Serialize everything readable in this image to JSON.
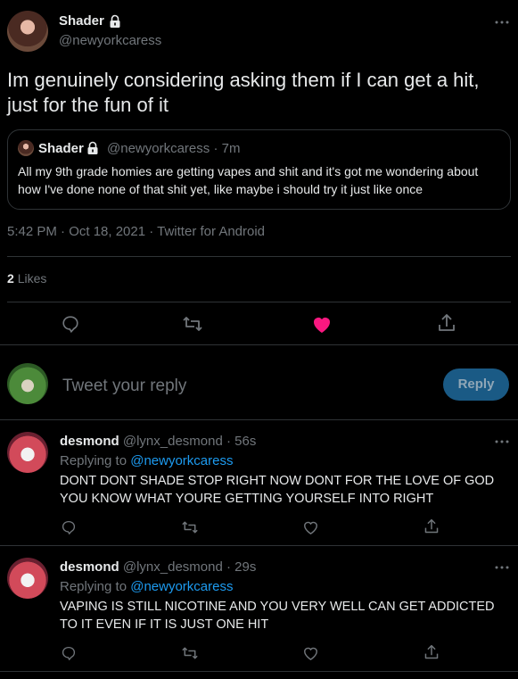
{
  "main_tweet": {
    "display_name": "Shader",
    "handle": "@newyorkcaress",
    "text": "Im genuinely considering asking them if I can get a hit, just for the fun of it",
    "timestamp": "5:42 PM · Oct 18, 2021 · Twitter for Android",
    "likes_count": "2",
    "likes_label": "Likes",
    "like_color": "#f91880"
  },
  "quoted_tweet": {
    "display_name": "Shader",
    "handle": "@newyorkcaress",
    "time": "· 7m",
    "text": "All my 9th grade homies are getting vapes and shit and it's got me wondering about how I've done none of that shit yet, like maybe i should try it just like once"
  },
  "reply_box": {
    "placeholder": "Tweet your reply",
    "button_label": "Reply",
    "button_color": "#1d9bf0"
  },
  "replies": [
    {
      "display_name": "desmond",
      "handle": "@lynx_desmond",
      "time": "· 56s",
      "replying_prefix": "Replying to",
      "replying_to": "@newyorkcaress",
      "text": "DONT DONT SHADE STOP RIGHT NOW DONT FOR THE LOVE OF GOD YOU KNOW WHAT YOURE GETTING YOURSELF INTO RIGHT"
    },
    {
      "display_name": "desmond",
      "handle": "@lynx_desmond",
      "time": "· 29s",
      "replying_prefix": "Replying to",
      "replying_to": "@newyorkcaress",
      "text": "VAPING IS STILL NICOTINE AND YOU VERY WELL CAN GET ADDICTED TO IT EVEN IF IT IS JUST ONE HIT"
    }
  ],
  "icons": [
    "lock-icon",
    "more-icon",
    "reply-icon",
    "retweet-icon",
    "like-icon",
    "share-icon"
  ]
}
